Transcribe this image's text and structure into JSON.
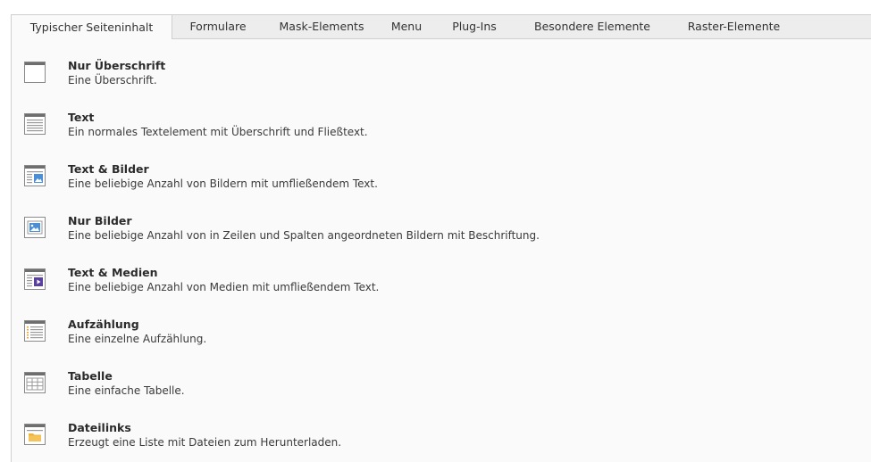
{
  "tabs": [
    {
      "label": "Typischer Seiteninhalt",
      "active": true
    },
    {
      "label": "Formulare"
    },
    {
      "label": "Mask-Elements"
    },
    {
      "label": "Menu"
    },
    {
      "label": "Plug-Ins"
    },
    {
      "label": "Besondere Elemente"
    },
    {
      "label": "Raster-Elemente"
    }
  ],
  "items": [
    {
      "icon": "header-only-icon",
      "title": "Nur Überschrift",
      "description": "Eine Überschrift."
    },
    {
      "icon": "text-icon",
      "title": "Text",
      "description": "Ein normales Textelement mit Überschrift und Fließtext."
    },
    {
      "icon": "text-image-icon",
      "title": "Text & Bilder",
      "description": "Eine beliebige Anzahl von Bildern mit umfließendem Text."
    },
    {
      "icon": "image-icon",
      "title": "Nur Bilder",
      "description": "Eine beliebige Anzahl von in Zeilen und Spalten angeordneten Bildern mit Beschriftung."
    },
    {
      "icon": "text-media-icon",
      "title": "Text & Medien",
      "description": "Eine beliebige Anzahl von Medien mit umfließendem Text."
    },
    {
      "icon": "bullet-list-icon",
      "title": "Aufzählung",
      "description": "Eine einzelne Aufzählung."
    },
    {
      "icon": "table-icon",
      "title": "Tabelle",
      "description": "Eine einfache Tabelle."
    },
    {
      "icon": "file-links-icon",
      "title": "Dateilinks",
      "description": "Erzeugt eine Liste mit Dateien zum Herunterladen."
    }
  ],
  "colors": {
    "icon_border": "#8a8a8a",
    "icon_header_bar": "#6e6e6e",
    "image_blue": "#4a8fd6",
    "media_purple": "#5a3fa0",
    "bullet_orange": "#e8a33d",
    "folder_yellow": "#f0b43c"
  }
}
